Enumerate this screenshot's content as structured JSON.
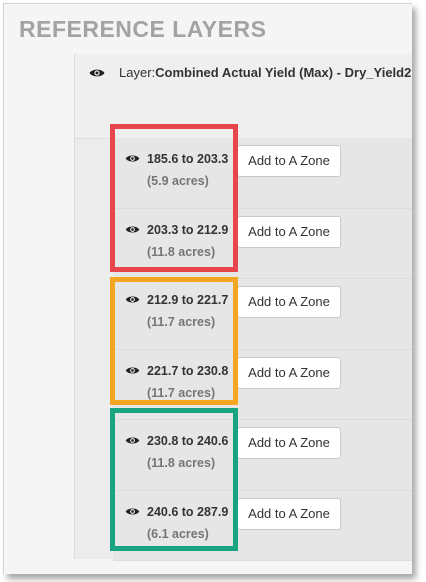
{
  "section_title": "REFERENCE LAYERS",
  "layer": {
    "prefix": "Layer:",
    "name": "Combined Actual Yield (Max) - Dry_Yield2",
    "icon": "eye-icon"
  },
  "ranges": [
    {
      "range": "185.6 to 203.3",
      "acres": "(5.9 acres)",
      "button": "Add to A Zone"
    },
    {
      "range": "203.3 to 212.9",
      "acres": "(11.8 acres)",
      "button": "Add to A Zone"
    },
    {
      "range": "212.9 to 221.7",
      "acres": "(11.7 acres)",
      "button": "Add to A Zone"
    },
    {
      "range": "221.7 to 230.8",
      "acres": "(11.7 acres)",
      "button": "Add to A Zone"
    },
    {
      "range": "230.8 to 240.6",
      "acres": "(11.8 acres)",
      "button": "Add to A Zone"
    },
    {
      "range": "240.6 to 287.9",
      "acres": "(6.1 acres)",
      "button": "Add to A Zone"
    }
  ],
  "highlight_colors": {
    "red": "#e8464d",
    "orange": "#f5a623",
    "green": "#18a47e"
  }
}
